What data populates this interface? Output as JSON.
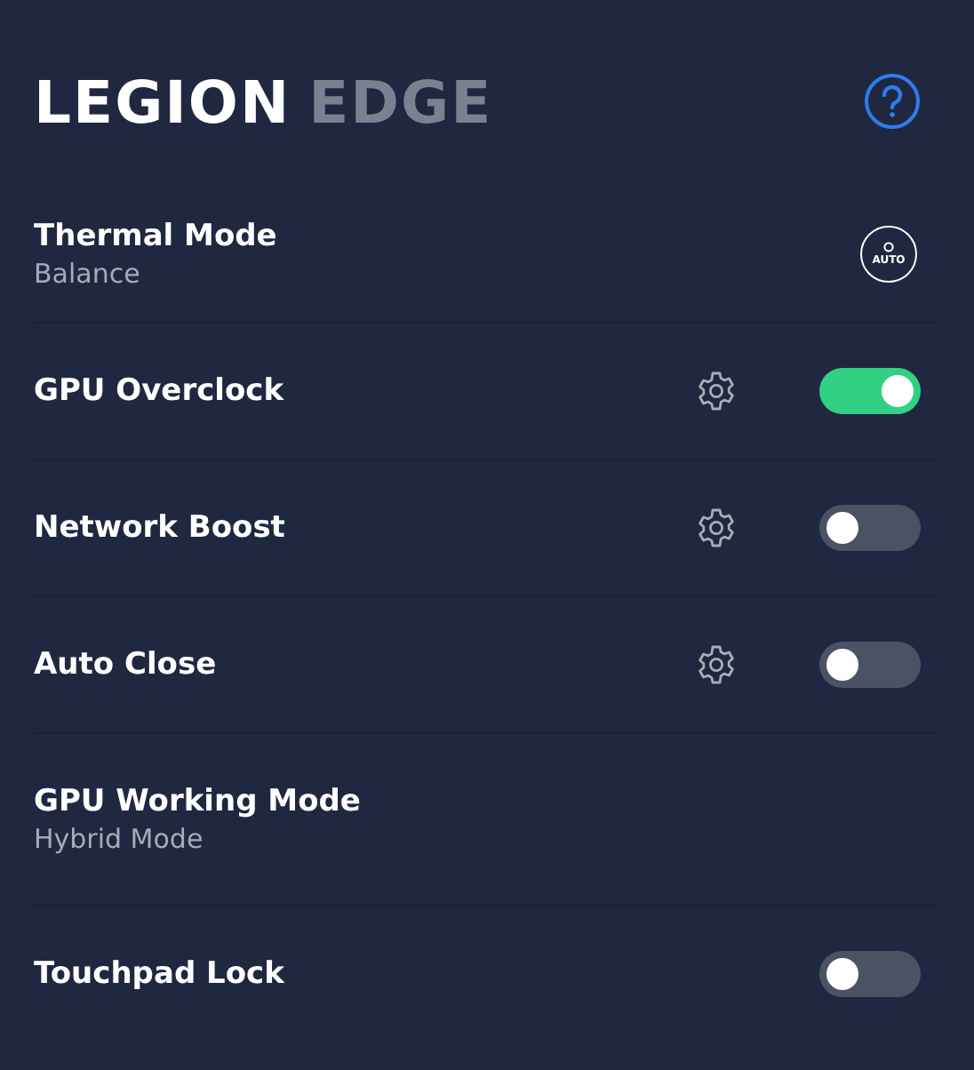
{
  "logo": {
    "brand": "LEGION",
    "product": "EDGE"
  },
  "rows": [
    {
      "kind": "mode",
      "title": "Thermal Mode",
      "subtitle": "Balance",
      "badge": "AUTO"
    },
    {
      "kind": "toggle",
      "title": "GPU Overclock",
      "settings": true,
      "on": true
    },
    {
      "kind": "toggle",
      "title": "Network Boost",
      "settings": true,
      "on": false
    },
    {
      "kind": "toggle",
      "title": "Auto Close",
      "settings": true,
      "on": false
    },
    {
      "kind": "mode",
      "title": "GPU Working Mode",
      "subtitle": "Hybrid Mode"
    },
    {
      "kind": "toggle",
      "title": "Touchpad Lock",
      "settings": false,
      "on": false
    }
  ]
}
